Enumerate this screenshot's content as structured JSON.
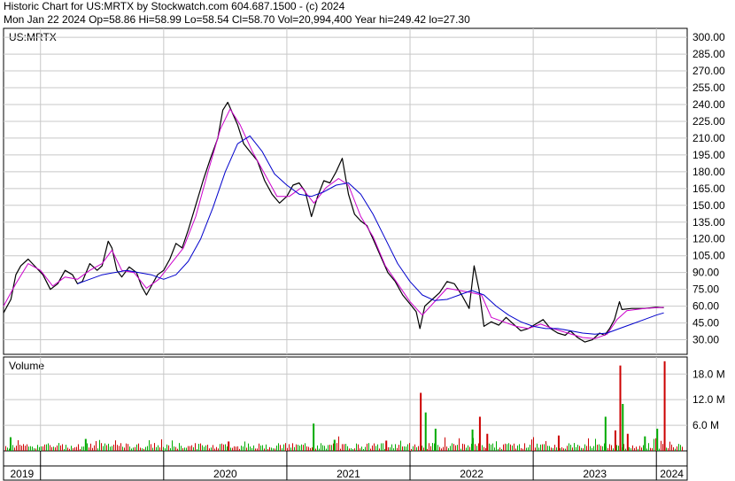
{
  "header": {
    "line1": "Historic Chart for US:MRTX by Stockwatch.com 604.687.1500 - (c) 2024",
    "line2": "Mon Jan 22 2024   Op=58.86  Hi=58.99  Lo=58.54  Cl=58.70  Vol=20,994,400   Year hi=249.42  lo=27.30"
  },
  "price_panel": {
    "label": "US:MRTX"
  },
  "volume_panel": {
    "label": "Volume"
  },
  "colors": {
    "price": "#000000",
    "ma_short": "#cc00cc",
    "ma_long": "#0000cc",
    "vol_up": "#00aa00",
    "vol_down": "#cc0000",
    "grid": "#c8c8c8"
  },
  "chart_data": [
    {
      "type": "line",
      "title": "",
      "xlabel": "",
      "ylabel": "",
      "y_ticks": [
        300,
        285,
        270,
        255,
        240,
        225,
        210,
        195,
        180,
        165,
        150,
        135,
        120,
        105,
        90,
        75,
        60,
        45,
        30
      ],
      "y_tick_labels": [
        "300.00",
        "285.00",
        "270.00",
        "255.00",
        "240.00",
        "225.00",
        "210.00",
        "195.00",
        "180.00",
        "165.00",
        "150.00",
        "135.00",
        "120.00",
        "105.00",
        "90.00",
        "75.00",
        "60.00",
        "45.00",
        "30.00"
      ],
      "ylim": [
        17,
        308
      ],
      "x_labels": [
        "2019",
        "2020",
        "2021",
        "2022",
        "2023",
        "2024"
      ],
      "x_label_pos": [
        2019.0,
        2020.0,
        2021.0,
        2022.0,
        2023.0,
        2024.0
      ],
      "xlim": [
        2018.7,
        2024.25
      ],
      "grid": true,
      "series": [
        {
          "key": "close",
          "points": [
            [
              2018.7,
              54
            ],
            [
              2018.76,
              66
            ],
            [
              2018.8,
              88
            ],
            [
              2018.84,
              96
            ],
            [
              2018.9,
              102
            ],
            [
              2018.96,
              95
            ],
            [
              2019.02,
              88
            ],
            [
              2019.08,
              75
            ],
            [
              2019.14,
              80
            ],
            [
              2019.2,
              92
            ],
            [
              2019.26,
              88
            ],
            [
              2019.3,
              80
            ],
            [
              2019.34,
              82
            ],
            [
              2019.4,
              98
            ],
            [
              2019.46,
              92
            ],
            [
              2019.5,
              96
            ],
            [
              2019.55,
              118
            ],
            [
              2019.58,
              112
            ],
            [
              2019.62,
              92
            ],
            [
              2019.66,
              86
            ],
            [
              2019.72,
              95
            ],
            [
              2019.78,
              90
            ],
            [
              2019.82,
              78
            ],
            [
              2019.86,
              70
            ],
            [
              2019.9,
              78
            ],
            [
              2019.95,
              88
            ],
            [
              2020.0,
              92
            ],
            [
              2020.05,
              102
            ],
            [
              2020.1,
              116
            ],
            [
              2020.15,
              112
            ],
            [
              2020.2,
              128
            ],
            [
              2020.26,
              150
            ],
            [
              2020.32,
              172
            ],
            [
              2020.38,
              192
            ],
            [
              2020.44,
              210
            ],
            [
              2020.48,
              235
            ],
            [
              2020.52,
              242
            ],
            [
              2020.56,
              232
            ],
            [
              2020.6,
              222
            ],
            [
              2020.65,
              205
            ],
            [
              2020.7,
              198
            ],
            [
              2020.76,
              190
            ],
            [
              2020.82,
              172
            ],
            [
              2020.88,
              160
            ],
            [
              2020.94,
              152
            ],
            [
              2021.0,
              158
            ],
            [
              2021.05,
              168
            ],
            [
              2021.1,
              170
            ],
            [
              2021.15,
              162
            ],
            [
              2021.2,
              140
            ],
            [
              2021.25,
              158
            ],
            [
              2021.3,
              172
            ],
            [
              2021.35,
              170
            ],
            [
              2021.4,
              180
            ],
            [
              2021.45,
              192
            ],
            [
              2021.5,
              160
            ],
            [
              2021.55,
              142
            ],
            [
              2021.6,
              136
            ],
            [
              2021.65,
              132
            ],
            [
              2021.7,
              120
            ],
            [
              2021.76,
              105
            ],
            [
              2021.82,
              90
            ],
            [
              2021.88,
              82
            ],
            [
              2021.94,
              70
            ],
            [
              2022.0,
              62
            ],
            [
              2022.05,
              55
            ],
            [
              2022.08,
              40
            ],
            [
              2022.12,
              60
            ],
            [
              2022.18,
              66
            ],
            [
              2022.24,
              72
            ],
            [
              2022.3,
              82
            ],
            [
              2022.36,
              80
            ],
            [
              2022.42,
              70
            ],
            [
              2022.48,
              58
            ],
            [
              2022.52,
              96
            ],
            [
              2022.56,
              75
            ],
            [
              2022.6,
              42
            ],
            [
              2022.66,
              46
            ],
            [
              2022.72,
              43
            ],
            [
              2022.78,
              50
            ],
            [
              2022.84,
              44
            ],
            [
              2022.9,
              38
            ],
            [
              2022.96,
              40
            ],
            [
              2023.02,
              44
            ],
            [
              2023.08,
              48
            ],
            [
              2023.14,
              40
            ],
            [
              2023.2,
              36
            ],
            [
              2023.26,
              34
            ],
            [
              2023.3,
              38
            ],
            [
              2023.36,
              32
            ],
            [
              2023.42,
              28
            ],
            [
              2023.48,
              30
            ],
            [
              2023.54,
              36
            ],
            [
              2023.58,
              34
            ],
            [
              2023.62,
              40
            ],
            [
              2023.66,
              48
            ],
            [
              2023.7,
              64
            ],
            [
              2023.72,
              57
            ],
            [
              2023.8,
              58
            ],
            [
              2023.9,
              58
            ],
            [
              2024.0,
              59
            ],
            [
              2024.06,
              58.7
            ]
          ]
        },
        {
          "key": "ma_short",
          "points": [
            [
              2018.7,
              60
            ],
            [
              2018.8,
              80
            ],
            [
              2018.9,
              98
            ],
            [
              2019.0,
              92
            ],
            [
              2019.1,
              78
            ],
            [
              2019.2,
              86
            ],
            [
              2019.3,
              84
            ],
            [
              2019.4,
              92
            ],
            [
              2019.5,
              98
            ],
            [
              2019.58,
              110
            ],
            [
              2019.66,
              92
            ],
            [
              2019.76,
              90
            ],
            [
              2019.86,
              76
            ],
            [
              2019.96,
              84
            ],
            [
              2020.06,
              98
            ],
            [
              2020.16,
              112
            ],
            [
              2020.26,
              140
            ],
            [
              2020.36,
              180
            ],
            [
              2020.46,
              218
            ],
            [
              2020.54,
              236
            ],
            [
              2020.62,
              222
            ],
            [
              2020.72,
              198
            ],
            [
              2020.82,
              178
            ],
            [
              2020.92,
              158
            ],
            [
              2021.02,
              158
            ],
            [
              2021.12,
              166
            ],
            [
              2021.22,
              152
            ],
            [
              2021.32,
              166
            ],
            [
              2021.42,
              174
            ],
            [
              2021.5,
              168
            ],
            [
              2021.6,
              140
            ],
            [
              2021.7,
              122
            ],
            [
              2021.8,
              96
            ],
            [
              2021.9,
              80
            ],
            [
              2022.0,
              64
            ],
            [
              2022.1,
              52
            ],
            [
              2022.2,
              64
            ],
            [
              2022.3,
              76
            ],
            [
              2022.4,
              74
            ],
            [
              2022.5,
              72
            ],
            [
              2022.58,
              70
            ],
            [
              2022.66,
              50
            ],
            [
              2022.76,
              46
            ],
            [
              2022.86,
              42
            ],
            [
              2022.96,
              40
            ],
            [
              2023.06,
              44
            ],
            [
              2023.16,
              40
            ],
            [
              2023.28,
              36
            ],
            [
              2023.4,
              32
            ],
            [
              2023.5,
              31
            ],
            [
              2023.6,
              35
            ],
            [
              2023.68,
              48
            ],
            [
              2023.76,
              56
            ],
            [
              2023.9,
              58
            ],
            [
              2024.06,
              59
            ]
          ]
        },
        {
          "key": "ma_long",
          "points": [
            [
              2019.3,
              80
            ],
            [
              2019.5,
              88
            ],
            [
              2019.7,
              92
            ],
            [
              2019.9,
              88
            ],
            [
              2020.0,
              84
            ],
            [
              2020.1,
              88
            ],
            [
              2020.2,
              100
            ],
            [
              2020.3,
              120
            ],
            [
              2020.4,
              148
            ],
            [
              2020.5,
              180
            ],
            [
              2020.6,
              205
            ],
            [
              2020.7,
              212
            ],
            [
              2020.8,
              198
            ],
            [
              2020.9,
              178
            ],
            [
              2021.0,
              168
            ],
            [
              2021.1,
              160
            ],
            [
              2021.2,
              158
            ],
            [
              2021.3,
              162
            ],
            [
              2021.4,
              168
            ],
            [
              2021.5,
              170
            ],
            [
              2021.6,
              160
            ],
            [
              2021.7,
              142
            ],
            [
              2021.8,
              120
            ],
            [
              2021.9,
              98
            ],
            [
              2022.0,
              82
            ],
            [
              2022.1,
              70
            ],
            [
              2022.2,
              65
            ],
            [
              2022.3,
              66
            ],
            [
              2022.4,
              70
            ],
            [
              2022.5,
              74
            ],
            [
              2022.6,
              70
            ],
            [
              2022.7,
              60
            ],
            [
              2022.8,
              52
            ],
            [
              2022.9,
              46
            ],
            [
              2023.0,
              42
            ],
            [
              2023.1,
              40
            ],
            [
              2023.2,
              40
            ],
            [
              2023.3,
              38
            ],
            [
              2023.4,
              36
            ],
            [
              2023.5,
              35
            ],
            [
              2023.6,
              36
            ],
            [
              2023.7,
              40
            ],
            [
              2023.8,
              44
            ],
            [
              2023.9,
              48
            ],
            [
              2024.0,
              52
            ],
            [
              2024.06,
              54
            ]
          ]
        }
      ]
    },
    {
      "type": "bar",
      "title": "",
      "xlabel": "",
      "ylabel": "",
      "y_ticks": [
        18000000,
        12000000,
        6000000
      ],
      "y_tick_labels": [
        "18.0 M",
        "12.0 M",
        "6.0 M"
      ],
      "ylim": [
        0,
        22000000
      ],
      "xlim": [
        2018.7,
        2024.25
      ],
      "spikes": [
        {
          "x": 2018.75,
          "v": 3200000,
          "up": true
        },
        {
          "x": 2019.36,
          "v": 2800000,
          "up": true
        },
        {
          "x": 2020.52,
          "v": 2200000,
          "up": false
        },
        {
          "x": 2021.21,
          "v": 6400000,
          "up": true
        },
        {
          "x": 2021.38,
          "v": 2600000,
          "up": true
        },
        {
          "x": 2021.8,
          "v": 2400000,
          "up": false
        },
        {
          "x": 2022.08,
          "v": 13600000,
          "up": false
        },
        {
          "x": 2022.12,
          "v": 9000000,
          "up": true
        },
        {
          "x": 2022.2,
          "v": 5200000,
          "up": true
        },
        {
          "x": 2022.5,
          "v": 5000000,
          "up": true
        },
        {
          "x": 2022.56,
          "v": 8000000,
          "up": false
        },
        {
          "x": 2022.62,
          "v": 4000000,
          "up": false
        },
        {
          "x": 2023.2,
          "v": 3600000,
          "up": false
        },
        {
          "x": 2023.58,
          "v": 8000000,
          "up": true
        },
        {
          "x": 2023.66,
          "v": 4800000,
          "up": false
        },
        {
          "x": 2023.7,
          "v": 20000000,
          "up": false
        },
        {
          "x": 2023.72,
          "v": 11000000,
          "up": true
        },
        {
          "x": 2023.76,
          "v": 4000000,
          "up": false
        },
        {
          "x": 2023.9,
          "v": 3400000,
          "up": true
        },
        {
          "x": 2024.0,
          "v": 5200000,
          "up": true
        },
        {
          "x": 2024.06,
          "v": 21000000,
          "up": false
        }
      ]
    }
  ]
}
